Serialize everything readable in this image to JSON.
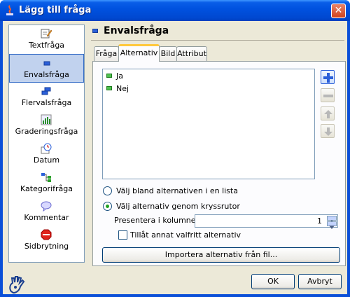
{
  "window": {
    "title": "Lägg till fråga",
    "close_label": "✕"
  },
  "sidebar": {
    "items": [
      {
        "label": "Textfråga",
        "icon": "text-question-icon"
      },
      {
        "label": "Envalsfråga",
        "icon": "single-choice-icon",
        "selected": true
      },
      {
        "label": "Flervalsfråga",
        "icon": "multi-choice-icon"
      },
      {
        "label": "Graderingsfråga",
        "icon": "rating-icon"
      },
      {
        "label": "Datum",
        "icon": "date-icon"
      },
      {
        "label": "Kategorifråga",
        "icon": "category-icon"
      },
      {
        "label": "Kommentar",
        "icon": "comment-icon"
      },
      {
        "label": "Sidbrytning",
        "icon": "page-break-icon"
      }
    ]
  },
  "header": {
    "title": "Envalsfråga"
  },
  "tabs": [
    {
      "label": "Fråga"
    },
    {
      "label": "Alternativ",
      "active": true
    },
    {
      "label": "Bild"
    },
    {
      "label": "Attribut"
    }
  ],
  "alternatives": {
    "items": [
      "Ja",
      "Nej"
    ]
  },
  "display_mode": {
    "list_option": "Välj bland alternativen i en lista",
    "checkbox_option": "Välj alternativ genom kryssrutor",
    "selected": "checkbox"
  },
  "columns": {
    "label": "Presentera i kolumner:",
    "value": "1"
  },
  "allow_other": {
    "label": "Tillåt annat valfritt alternativ",
    "checked": false
  },
  "import_button": "Importera alternativ från fil...",
  "footer": {
    "ok": "OK",
    "cancel": "Avbryt"
  },
  "colors": {
    "title_bar": "#0054e3",
    "dialog_bg": "#ece9d8",
    "selection": "#c1d2ee"
  }
}
